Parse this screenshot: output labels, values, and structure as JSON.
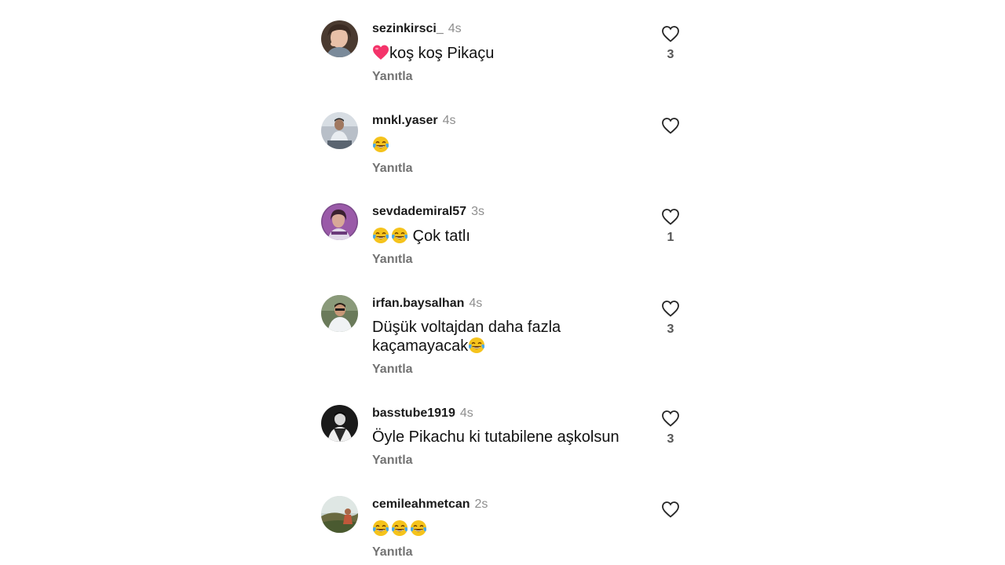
{
  "reply_label": "Yanıtla",
  "colors": {
    "username": "#1a1a1a",
    "timestamp": "#8e8e8e",
    "reply": "#737373",
    "heart_outline": "#262626",
    "emoji_face": "#f5c31c",
    "emoji_tear": "#4aa8e8",
    "heart_emoji": "#f4336a"
  },
  "comments": [
    {
      "username": "sezinkirsci_",
      "time": "4s",
      "text_pre_icon": "heart-emoji",
      "text": "koş koş Pikaçu",
      "likes": "3"
    },
    {
      "username": "mnkl.yaser",
      "time": "4s",
      "text": "",
      "text_emoji": "face-with-tears-of-joy",
      "text_emoji_count": 1,
      "likes": ""
    },
    {
      "username": "sevdademiral57",
      "time": "3s",
      "text": " Çok tatlı",
      "text_emoji": "face-with-tears-of-joy",
      "text_emoji_count": 2,
      "likes": "1"
    },
    {
      "username": "irfan.baysalhan",
      "time": "4s",
      "text_line1": "Düşük voltajdan daha fazla",
      "text_line2": "kaçamayacak",
      "text_emoji": "face-with-tears-of-joy",
      "text_emoji_count": 1,
      "likes": "3"
    },
    {
      "username": "basstube1919",
      "time": "4s",
      "text": "Öyle Pikachu ki tutabilene aşkolsun",
      "likes": "3"
    },
    {
      "username": "cemileahmetcan",
      "time": "2s",
      "text": "",
      "text_emoji": "face-with-tears-of-joy",
      "text_emoji_count": 3,
      "likes": ""
    }
  ]
}
